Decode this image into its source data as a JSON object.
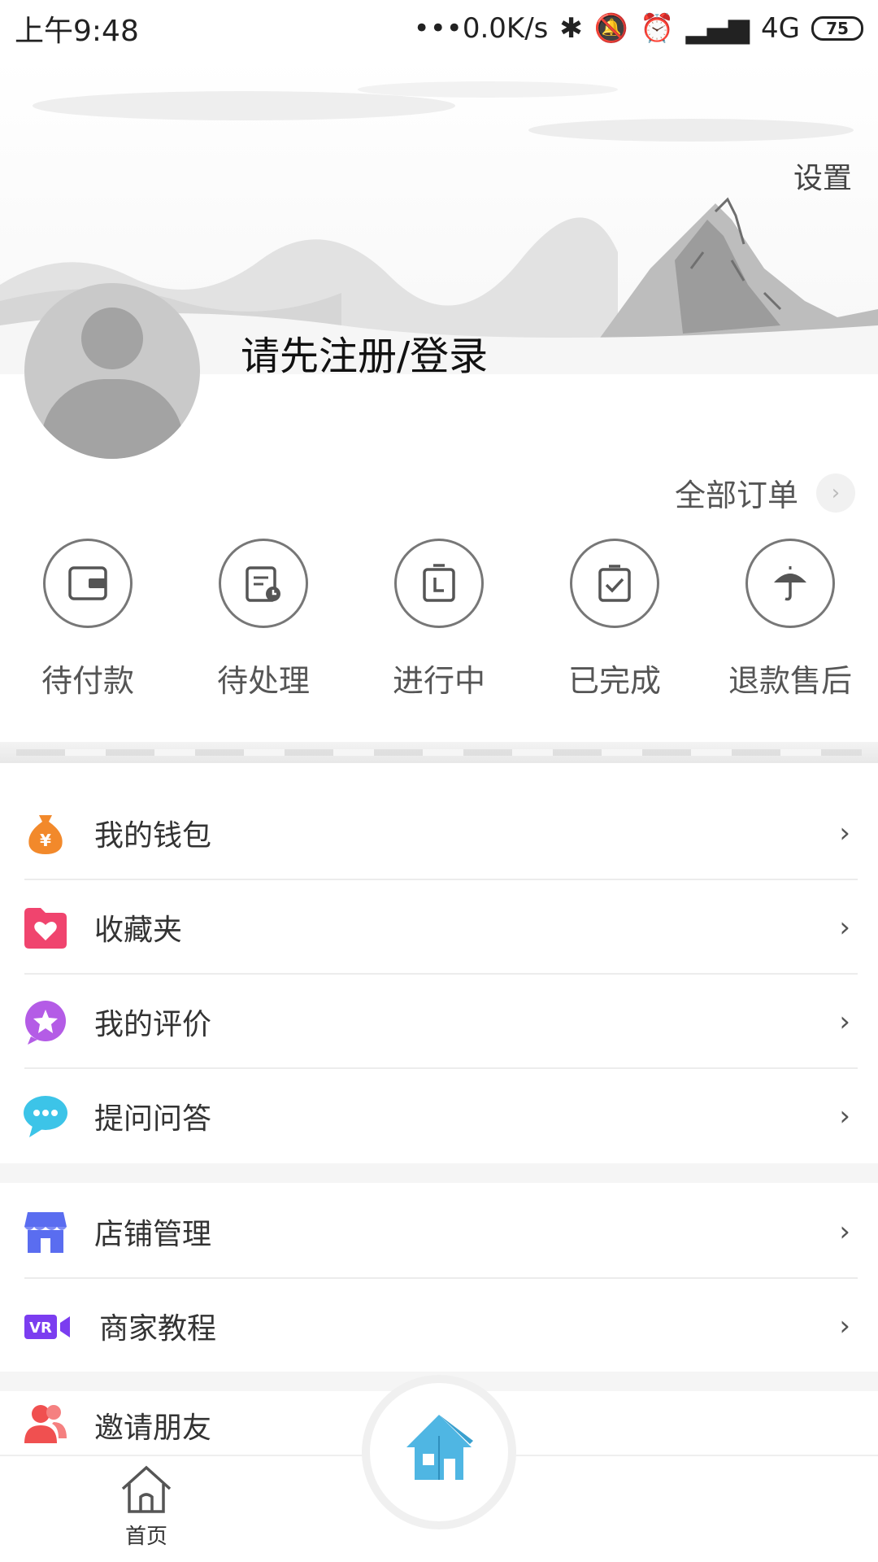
{
  "status_bar": {
    "time": "上午9:48",
    "network_speed": "•••0.0K/s",
    "network_type": "4G",
    "battery": "75"
  },
  "header": {
    "settings": "设置",
    "login_prompt": "请先注册/登录"
  },
  "orders": {
    "all_orders": "全部订单",
    "items": [
      {
        "label": "待付款",
        "icon": "wallet-icon"
      },
      {
        "label": "待处理",
        "icon": "clipboard-clock-icon"
      },
      {
        "label": "进行中",
        "icon": "clock-note-icon"
      },
      {
        "label": "已完成",
        "icon": "clipboard-check-icon"
      },
      {
        "label": "退款售后",
        "icon": "umbrella-icon"
      }
    ]
  },
  "menu": {
    "group1": [
      {
        "label": "我的钱包",
        "icon": "money-bag-icon"
      },
      {
        "label": "收藏夹",
        "icon": "heart-folder-icon"
      },
      {
        "label": "我的评价",
        "icon": "star-chat-icon"
      },
      {
        "label": "提问问答",
        "icon": "chat-bubble-icon"
      }
    ],
    "group2": [
      {
        "label": "店铺管理",
        "icon": "shop-icon"
      },
      {
        "label": "商家教程",
        "icon": "vr-video-icon"
      }
    ],
    "group3": [
      {
        "label": "邀请朋友",
        "icon": "users-icon"
      }
    ]
  },
  "bottom_nav": {
    "home": "首页"
  },
  "colors": {
    "wallet_orange": "#f2892b",
    "favorites_pink": "#f0446e",
    "review_purple": "#b45ce6",
    "chat_cyan": "#3cc4e8",
    "shop_blue": "#5a6df0",
    "vr_purple": "#7b3df0",
    "invite_red": "#f05050",
    "center_blue": "#4fb6e3"
  }
}
